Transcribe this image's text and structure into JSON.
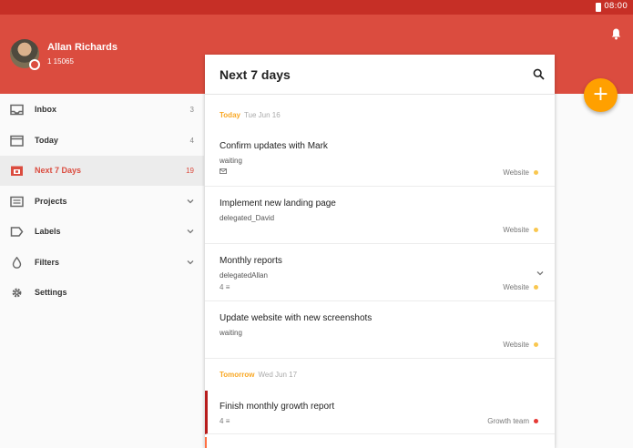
{
  "status_bar": {
    "time": "08:00",
    "battery_icon": "battery-icon"
  },
  "user": {
    "name": "Allan Richards",
    "karma": "1 15065"
  },
  "sidebar": {
    "items": [
      {
        "label": "Inbox",
        "count": "3",
        "icon": "inbox-icon"
      },
      {
        "label": "Today",
        "count": "4",
        "icon": "calendar-icon"
      },
      {
        "label": "Next 7 Days",
        "count": "19",
        "icon": "calendar-week-icon",
        "active": true
      },
      {
        "label": "Projects",
        "icon": "list-icon",
        "expandable": true
      },
      {
        "label": "Labels",
        "icon": "label-icon",
        "expandable": true
      },
      {
        "label": "Filters",
        "icon": "drop-icon",
        "expandable": true
      },
      {
        "label": "Settings",
        "icon": "gear-icon"
      }
    ]
  },
  "main": {
    "title": "Next 7 days",
    "sections": [
      {
        "day": "Today",
        "date": "Tue Jun 16"
      },
      {
        "day": "Tomorrow",
        "date": "Wed Jun 17"
      }
    ],
    "tasks": [
      {
        "title": "Confirm updates with Mark",
        "label": "waiting",
        "meta": "",
        "project": "Website"
      },
      {
        "title": "Implement new landing page",
        "label": "delegated_David",
        "meta": "",
        "project": "Website"
      },
      {
        "title": "Monthly reports",
        "label": "delegatedAllan",
        "meta": "4",
        "project": "Website"
      },
      {
        "title": "Update website with new screenshots",
        "label": "waiting",
        "meta": "",
        "project": "Website"
      },
      {
        "title": "Finish monthly growth report",
        "label": "",
        "meta": "4",
        "project": "Growth team"
      }
    ]
  },
  "fab": {
    "label": "+"
  },
  "colors": {
    "brand": "#db4c3f",
    "accent": "#ffa000",
    "project_website": "#f9c74f",
    "project_growth": "#e53935"
  }
}
